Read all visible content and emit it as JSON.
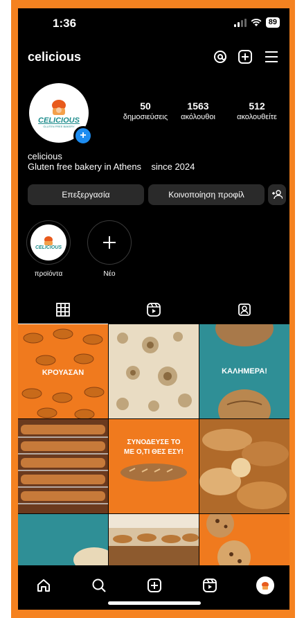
{
  "status_bar": {
    "time": "1:36",
    "battery": "89"
  },
  "header": {
    "username": "celicious"
  },
  "profile": {
    "logo_text": "CELICIOUS",
    "logo_subtext": "GLUTEN FREE BAKERY",
    "stats": [
      {
        "num": "50",
        "label": "δημοσιεύσεις"
      },
      {
        "num": "1563",
        "label": "ακόλουθοι"
      },
      {
        "num": "512",
        "label": "ακολουθείτε"
      }
    ],
    "name": "celicious",
    "bio": "Gluten free bakery in Athens    since 2024"
  },
  "buttons": {
    "edit": "Επεξεργασία",
    "share": "Κοινοποίηση προφίλ"
  },
  "highlights": [
    {
      "label": "προϊόντα"
    },
    {
      "label": "Νέο"
    }
  ],
  "posts": {
    "croissant_text": "ΚΡΟΥΑΣΑΝ",
    "morning_text": "ΚΑΛΗΜΕΡΑ!",
    "combine_text_1": "ΣΥΝΟΔΕΥΣΕ ΤΟ",
    "combine_text_2": "ΜΕ Ο,ΤΙ ΘΕΣ ΕΣΥ!"
  },
  "colors": {
    "brand_orange": "#f58220",
    "teal": "#2f8f96",
    "badge_blue": "#1d8cf0"
  }
}
